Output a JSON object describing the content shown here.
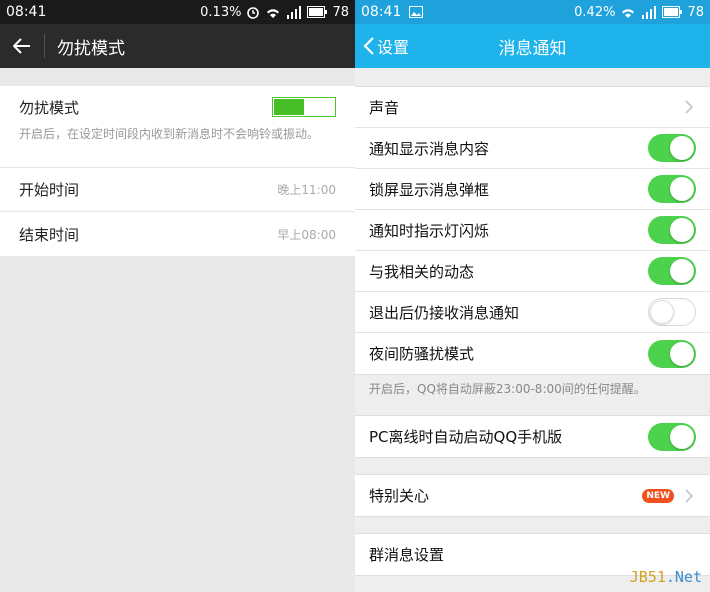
{
  "left": {
    "status": {
      "time": "08:41",
      "speed": "0.13%",
      "battery": "78"
    },
    "title": "勿扰模式",
    "dnd": {
      "label": "勿扰模式",
      "desc": "开启后，在设定时间段内收到新消息时不会响铃或振动。",
      "enabled": true
    },
    "start": {
      "label": "开始时间",
      "value": "晚上11:00"
    },
    "end": {
      "label": "结束时间",
      "value": "早上08:00"
    }
  },
  "right": {
    "status": {
      "time": "08:41",
      "speed": "0.42%",
      "battery": "78"
    },
    "back_label": "设置",
    "title": "消息通知",
    "rows": [
      {
        "label": "声音",
        "type": "chevron"
      },
      {
        "label": "通知显示消息内容",
        "type": "toggle",
        "on": true
      },
      {
        "label": "锁屏显示消息弹框",
        "type": "toggle",
        "on": true
      },
      {
        "label": "通知时指示灯闪烁",
        "type": "toggle",
        "on": true
      },
      {
        "label": "与我相关的动态",
        "type": "toggle",
        "on": true
      },
      {
        "label": "退出后仍接收消息通知",
        "type": "toggle",
        "on": false
      },
      {
        "label": "夜间防骚扰模式",
        "type": "toggle",
        "on": true
      }
    ],
    "night_note": "开启后，QQ将自动屏蔽23:00-8:00间的任何提醒。",
    "pc_row": {
      "label": "PC离线时自动启动QQ手机版",
      "on": true
    },
    "special": {
      "label": "特别关心",
      "badge": "NEW"
    },
    "group_settings": {
      "label": "群消息设置"
    }
  },
  "watermark": {
    "part1": "JB51",
    "part2": ".Net"
  },
  "colors": {
    "toggle_on": "#4cd24c",
    "accent_blue": "#1fb3ec",
    "badge_red": "#f0501e"
  }
}
